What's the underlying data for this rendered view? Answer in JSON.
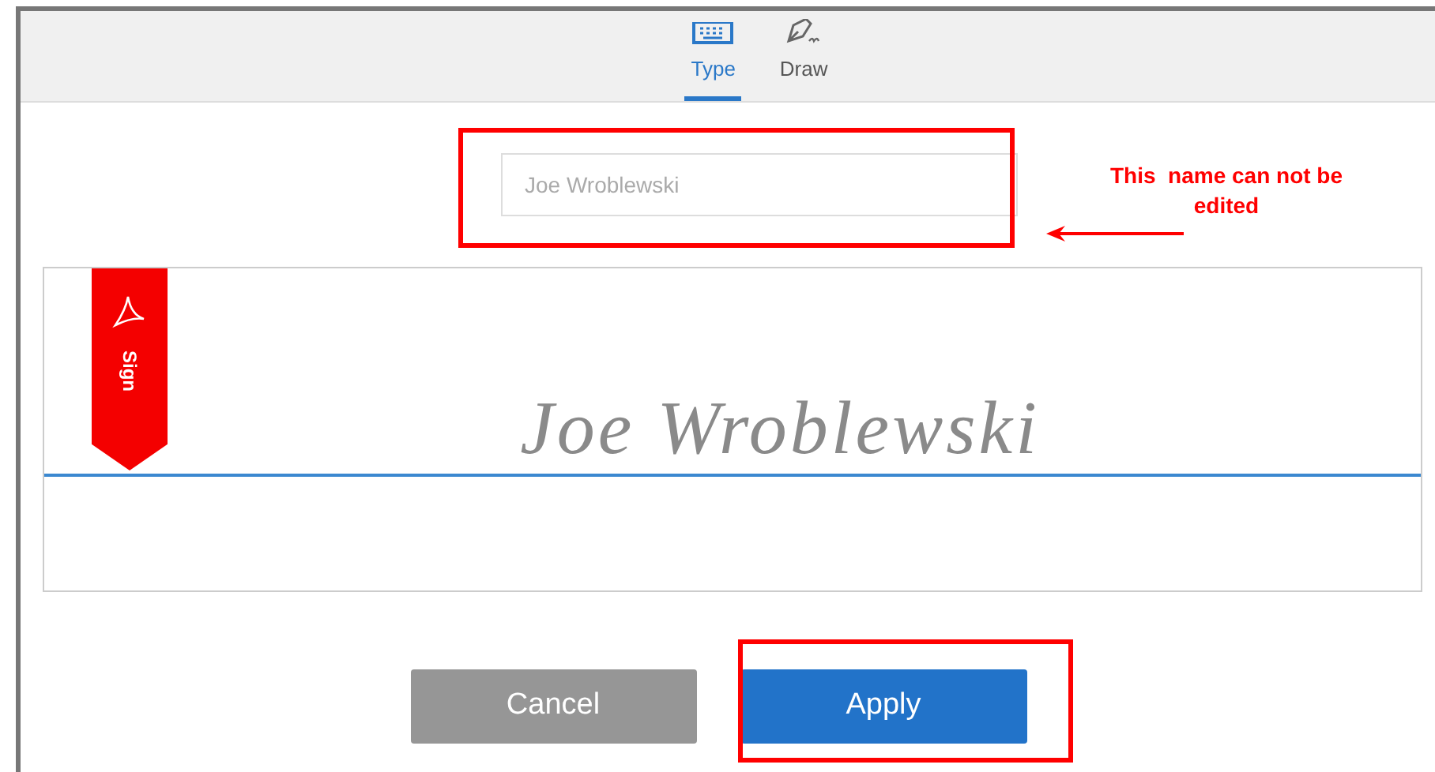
{
  "tabs": [
    {
      "label": "Type",
      "kind": "keyboard",
      "selected": true
    },
    {
      "label": "Draw",
      "kind": "pen",
      "selected": false
    }
  ],
  "name_field": {
    "value": "Joe Wroblewski",
    "disabled": true
  },
  "annotation": "This  name can not be edited",
  "signature": {
    "ribbon_label": "Sign",
    "text": "Joe Wroblewski"
  },
  "buttons": [
    {
      "label": "Cancel",
      "kind": "secondary"
    },
    {
      "label": "Apply",
      "kind": "primary"
    }
  ]
}
